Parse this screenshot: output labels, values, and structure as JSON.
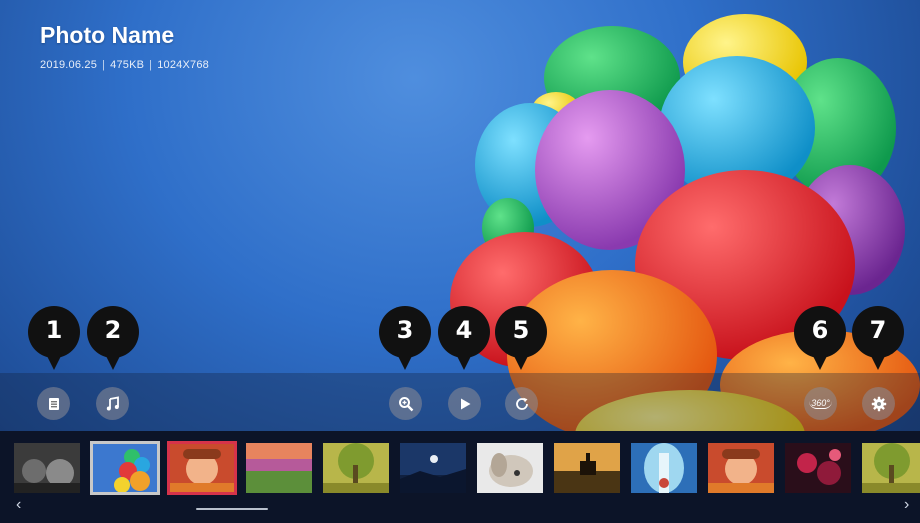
{
  "photo": {
    "name": "Photo Name",
    "date": "2019.06.25",
    "size": "475KB",
    "resolution": "1024X768",
    "separator": "|"
  },
  "controls": {
    "list": {
      "icon": "list-icon",
      "callout": "1"
    },
    "music": {
      "icon": "music-note-icon",
      "callout": "2"
    },
    "zoom": {
      "icon": "zoom-in-icon",
      "callout": "3"
    },
    "play": {
      "icon": "play-icon",
      "callout": "4"
    },
    "rotate": {
      "icon": "rotate-icon",
      "callout": "5"
    },
    "view360": {
      "icon": "360-view-icon",
      "label": "360°",
      "callout": "6"
    },
    "settings": {
      "icon": "gear-icon",
      "callout": "7"
    }
  },
  "thumbnails": [
    {
      "subject": "cats",
      "selected": false
    },
    {
      "subject": "balloons",
      "selected": true
    },
    {
      "subject": "child",
      "selected": true
    },
    {
      "subject": "sunset field",
      "selected": false
    },
    {
      "subject": "tree",
      "selected": false
    },
    {
      "subject": "night moon",
      "selected": false
    },
    {
      "subject": "dog",
      "selected": false
    },
    {
      "subject": "horse rider",
      "selected": false
    },
    {
      "subject": "waterfall",
      "selected": false
    },
    {
      "subject": "child",
      "selected": false
    },
    {
      "subject": "red lights",
      "selected": false
    },
    {
      "subject": "tree",
      "selected": false
    }
  ],
  "strip": {
    "prev_icon": "chevron-left-icon",
    "next_icon": "chevron-right-icon"
  },
  "colors": {
    "sky": "#2f6fc9",
    "callout": "#111111",
    "control_button": "#8c8c96",
    "thumb_highlight_gray": "#c8c8c8",
    "thumb_highlight_red": "#d6334a"
  }
}
